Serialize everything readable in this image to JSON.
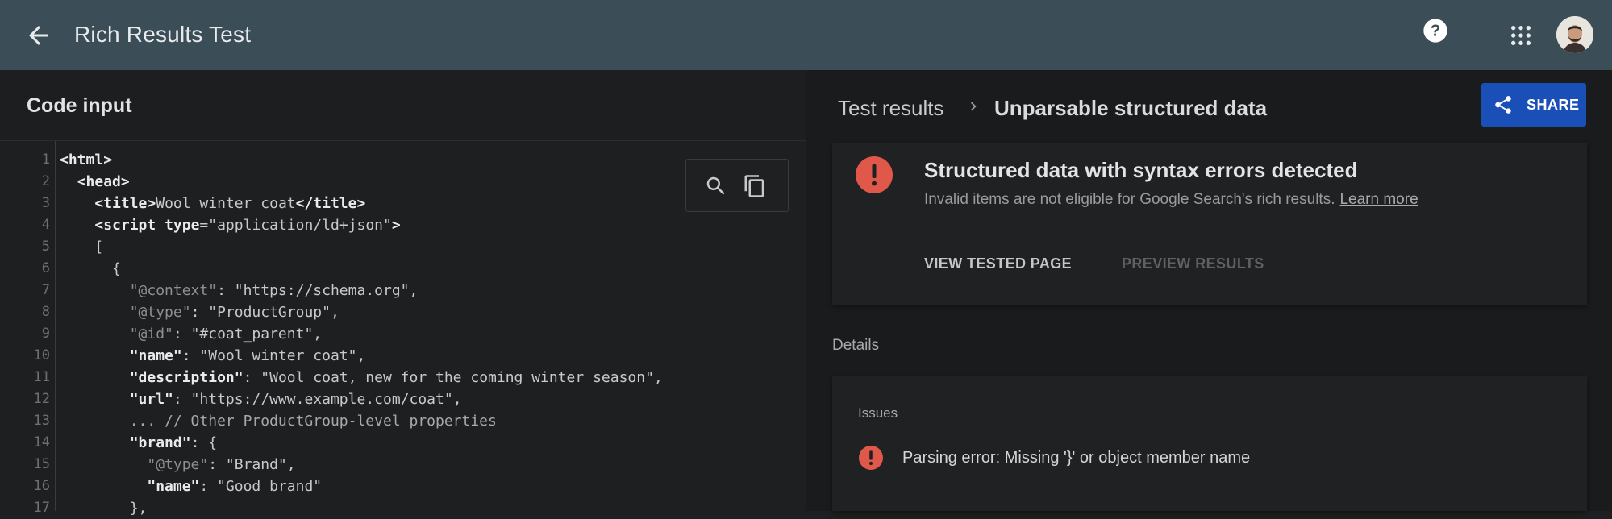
{
  "header": {
    "title": "Rich Results Test",
    "back_icon": "arrow-back-icon",
    "help_icon": "help-icon",
    "apps_icon": "apps-grid-icon"
  },
  "code_panel": {
    "title": "Code input",
    "tools": [
      "search-icon",
      "copy-icon"
    ],
    "line_numbers": [
      "1",
      "2",
      "3",
      "4",
      "5",
      "6",
      "7",
      "8",
      "9",
      "10",
      "11",
      "12",
      "13",
      "14",
      "15",
      "16",
      "17"
    ],
    "lines": [
      "<html>",
      "  <head>",
      "    <title>Wool winter coat</title>",
      "    <script type=\"application/ld+json\">",
      "    [",
      "      {",
      "        \"@context\": \"https://schema.org\",",
      "        \"@type\": \"ProductGroup\",",
      "        \"@id\": \"#coat_parent\",",
      "        \"name\": \"Wool winter coat\",",
      "        \"description\": \"Wool coat, new for the coming winter season\",",
      "        \"url\": \"https://www.example.com/coat\",",
      "        ... // Other ProductGroup-level properties",
      "        \"brand\": {",
      "          \"@type\": \"Brand\",",
      "          \"name\": \"Good brand\"",
      "        },"
    ]
  },
  "results_panel": {
    "breadcrumb_1": "Test results",
    "breadcrumb_2": "Unparsable structured data",
    "share_label": "SHARE",
    "summary_title": "Structured data with syntax errors detected",
    "summary_text": "Invalid items are not eligible for Google Search's rich results.",
    "learn_more": "Learn more",
    "view_tested_page": "VIEW TESTED PAGE",
    "preview_results": "PREVIEW RESULTS",
    "details_label": "Details",
    "issues_label": "Issues",
    "issue_text": "Parsing error: Missing '}' or object member name"
  },
  "colors": {
    "topbar": "#3b4d56",
    "share_button": "#1a4fb8",
    "error_red": "#e0584a"
  }
}
